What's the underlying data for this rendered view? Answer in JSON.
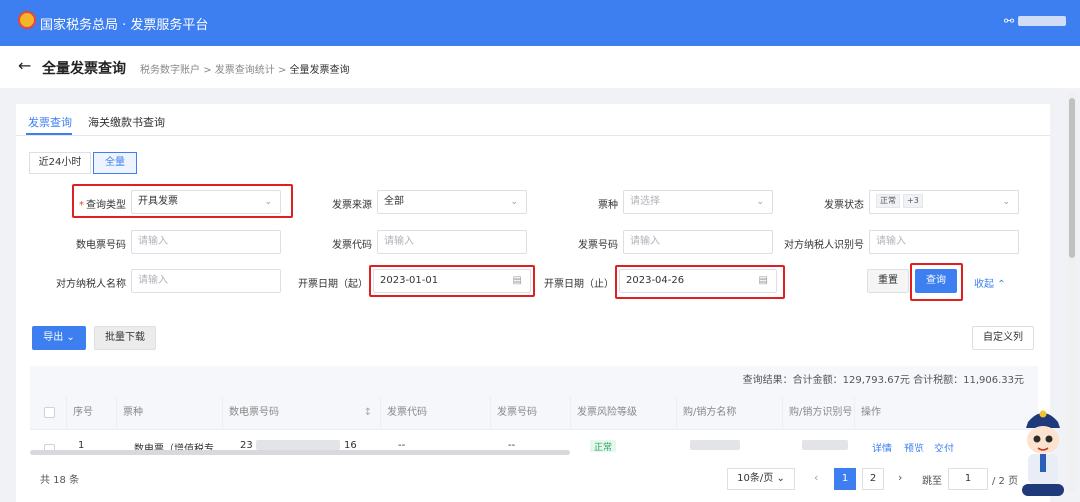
{
  "topbar": {
    "title": "国家税务总局 · 发票服务平台",
    "user_icon": "user-icon"
  },
  "breadcrumb": {
    "back_icon": "arrow-left-icon",
    "page_title": "全量发票查询",
    "items": [
      "税务数字账户",
      "发票查询统计",
      "全量发票查询"
    ],
    "separator": ">"
  },
  "tabs": [
    "发票查询",
    "海关缴款书查询"
  ],
  "time_filter": {
    "options": [
      "近24小时",
      "全量"
    ],
    "selected": "全量"
  },
  "form": {
    "query_type": {
      "label": "查询类型",
      "value": "开具发票"
    },
    "invoice_source": {
      "label": "发票来源",
      "value": "全部"
    },
    "invoice_kind": {
      "label": "票种",
      "placeholder": "请选择"
    },
    "invoice_status": {
      "label": "发票状态",
      "tag": "正常",
      "more": "+3"
    },
    "digital_invoice_no": {
      "label": "数电票号码",
      "placeholder": "请输入"
    },
    "invoice_code": {
      "label": "发票代码",
      "placeholder": "请输入"
    },
    "invoice_no": {
      "label": "发票号码",
      "placeholder": "请输入"
    },
    "counterpart_tax_id": {
      "label": "对方纳税人识别号",
      "placeholder": "请输入"
    },
    "counterpart_name": {
      "label": "对方纳税人名称",
      "placeholder": "请输入"
    },
    "date_start": {
      "label": "开票日期（起）",
      "value": "2023-01-01"
    },
    "date_end": {
      "label": "开票日期（止）",
      "value": "2023-04-26"
    }
  },
  "buttons": {
    "reset": "重置",
    "query": "查询",
    "collapse": "收起",
    "export": "导出",
    "batch_download": "批量下载",
    "custom_columns": "自定义列"
  },
  "summary": "查询结果：合计金额：129,793.67元   合计税额：11,906.33元",
  "table": {
    "headers": [
      "序号",
      "票种",
      "数电票号码",
      "发票代码",
      "发票号码",
      "发票风险等级",
      "购/销方名称",
      "购/销方识别号",
      "操作"
    ],
    "rows": [
      {
        "index": "1",
        "kind": "数电票（增值税专",
        "number_prefix": "23",
        "number_suffix": "16",
        "code": "--",
        "no": "--",
        "risk": "正常",
        "actions": [
          "详情",
          "预览",
          "交付"
        ]
      }
    ]
  },
  "pagination": {
    "total": "共 18 条",
    "page_size": "10条/页",
    "pages": [
      "1",
      "2"
    ],
    "current": "1",
    "goto_label": "跳至",
    "goto_value": "1",
    "of_total": "/ 2 页"
  }
}
